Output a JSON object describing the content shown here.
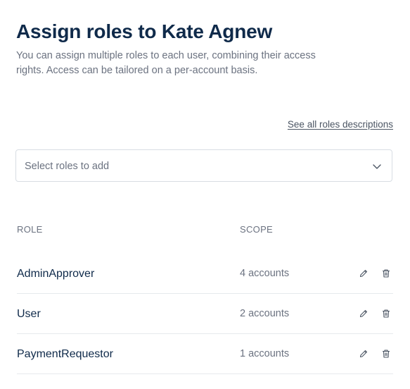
{
  "header": {
    "title": "Assign roles to Kate Agnew",
    "subtitle": "You can assign multiple roles to each user, combining their access rights. Access can be tailored on a per-account basis."
  },
  "links": {
    "see_all_roles": "See all roles descriptions"
  },
  "role_select": {
    "placeholder": "Select roles to add",
    "icon": "chevron-down-icon"
  },
  "table": {
    "columns": [
      "ROLE",
      "SCOPE"
    ],
    "rows": [
      {
        "role": "AdminApprover",
        "scope": "4 accounts"
      },
      {
        "role": "User",
        "scope": "2 accounts"
      },
      {
        "role": "PaymentRequestor",
        "scope": "1 accounts"
      }
    ],
    "row_actions": [
      "pencil-icon",
      "trash-icon"
    ]
  },
  "colors": {
    "heading": "#0f2a4a",
    "muted_text": "#6b7280",
    "border": "#d8dde3",
    "divider": "#e6e9ed"
  }
}
